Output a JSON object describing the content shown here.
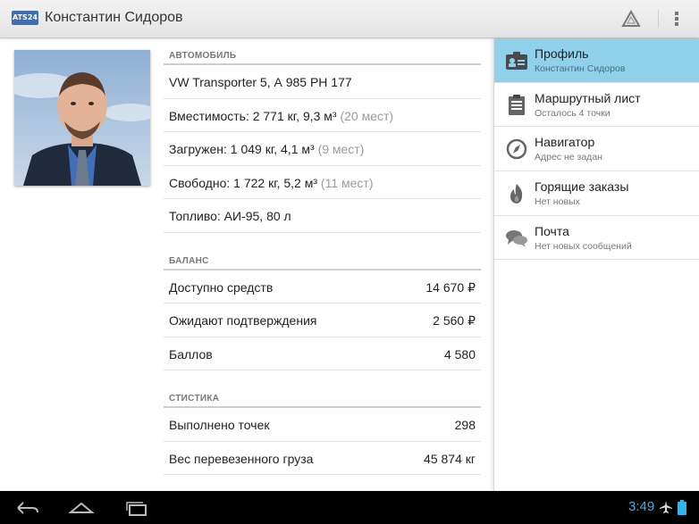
{
  "app": {
    "logo_text": "ATS24",
    "title": "Константин Сидоров"
  },
  "vehicle": {
    "header": "АВТОМОБИЛЬ",
    "rows": [
      {
        "label": "VW Transporter 5, А 985 РН 177",
        "extra": ""
      },
      {
        "label": "Вместимость: 2 771 кг,  9,3 м³",
        "extra": "(20 мест)"
      },
      {
        "label": "Загружен: 1 049 кг,  4,1 м³",
        "extra": "(9 мест)"
      },
      {
        "label": "Свободно: 1 722 кг,  5,2 м³",
        "extra": "(11 мест)"
      },
      {
        "label": "Топливо: АИ-95, 80 л",
        "extra": ""
      }
    ]
  },
  "balance": {
    "header": "БАЛАНС",
    "rows": [
      {
        "label": "Доступно средств",
        "value": "14 670 ₽"
      },
      {
        "label": "Ожидают подтверждения",
        "value": "2 560 ₽"
      },
      {
        "label": "Баллов",
        "value": "4 580"
      }
    ]
  },
  "stats": {
    "header": "СТИСТИКА",
    "rows": [
      {
        "label": "Выполнено точек",
        "value": "298"
      },
      {
        "label": "Вес перевезенного груза",
        "value": "45 874 кг"
      }
    ]
  },
  "nav": [
    {
      "title": "Профиль",
      "subtitle": "Константин Сидоров",
      "icon": "profile-card-icon",
      "active": true
    },
    {
      "title": "Маршрутный лист",
      "subtitle": "Осталось 4 точки",
      "icon": "clipboard-icon",
      "active": false
    },
    {
      "title": "Навигатор",
      "subtitle": "Адрес не задан",
      "icon": "compass-icon",
      "active": false
    },
    {
      "title": "Горящие заказы",
      "subtitle": "Нет новых",
      "icon": "fire-icon",
      "active": false
    },
    {
      "title": "Почта",
      "subtitle": "Нет новых сообщений",
      "icon": "chat-bubbles-icon",
      "active": false
    }
  ],
  "system": {
    "clock": "3:49"
  },
  "colors": {
    "accent": "#33b5e5",
    "active_nav": "#8fd0ea",
    "logo": "#3f6fb0"
  }
}
